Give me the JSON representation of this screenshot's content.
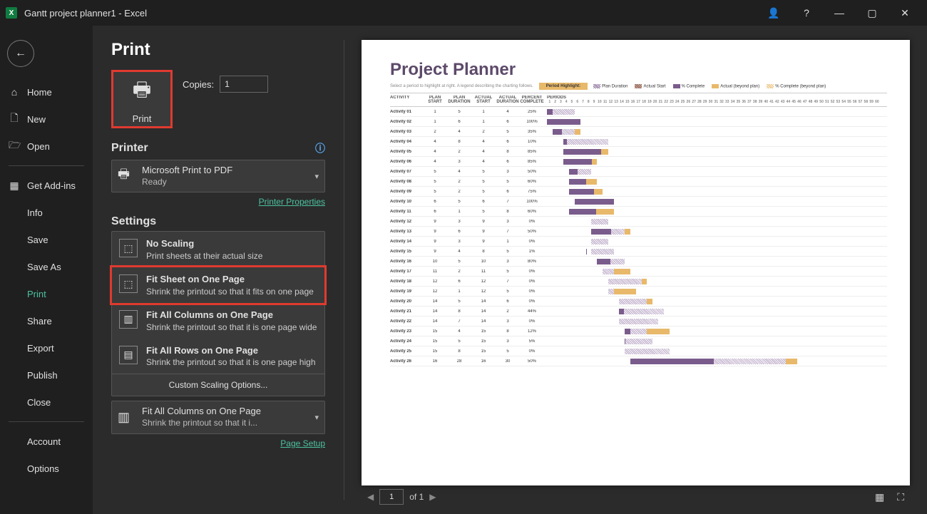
{
  "titlebar": {
    "app_icon": "X",
    "title": "Gantt project planner1  -  Excel"
  },
  "nav": {
    "home": "Home",
    "new": "New",
    "open": "Open",
    "getaddins": "Get Add-ins",
    "info": "Info",
    "save": "Save",
    "saveas": "Save As",
    "print": "Print",
    "share": "Share",
    "export": "Export",
    "publish": "Publish",
    "close": "Close",
    "account": "Account",
    "options": "Options"
  },
  "page": {
    "title": "Print",
    "copies_label": "Copies:",
    "copies_value": "1",
    "print_button": "Print"
  },
  "printer": {
    "section": "Printer",
    "name": "Microsoft Print to PDF",
    "status": "Ready",
    "properties": "Printer Properties"
  },
  "settings": {
    "section": "Settings",
    "custom": "Custom Scaling Options...",
    "page_setup": "Page Setup"
  },
  "scaling_options": [
    {
      "title": "No Scaling",
      "desc": "Print sheets at their actual size"
    },
    {
      "title": "Fit Sheet on One Page",
      "desc": "Shrink the printout so that it fits on one page"
    },
    {
      "title": "Fit All Columns on One Page",
      "desc": "Shrink the printout so that it is one page wide"
    },
    {
      "title": "Fit All Rows on One Page",
      "desc": "Shrink the printout so that it is one page high"
    }
  ],
  "current_setting": {
    "title": "Fit All Columns on One Page",
    "desc": "Shrink the printout so that it i..."
  },
  "pager": {
    "current": "1",
    "total": "of 1"
  },
  "preview": {
    "title": "Project Planner",
    "subtitle": "Select a period to highlight at right. A legend describing the charting follows.",
    "period_highlight": "Period Highlight:",
    "legend": {
      "pd": "Plan Duration",
      "as": "Actual Start",
      "pc": "% Complete",
      "ab": "Actual (beyond plan)",
      "cb": "% Complete (beyond plan)"
    },
    "headers": {
      "activity": "ACTIVITY",
      "planstart": "PLAN START",
      "plandur": "PLAN DURATION",
      "actstart": "ACTUAL START",
      "actdur": "ACTUAL DURATION",
      "pct": "PERCENT COMPLETE",
      "periods": "PERIODS"
    },
    "rows": [
      {
        "a": "Activity 01",
        "ps": 1,
        "pd": 5,
        "as": 1,
        "ad": 4,
        "pc": "25%"
      },
      {
        "a": "Activity 02",
        "ps": 1,
        "pd": 6,
        "as": 1,
        "ad": 6,
        "pc": "100%"
      },
      {
        "a": "Activity 03",
        "ps": 2,
        "pd": 4,
        "as": 2,
        "ad": 5,
        "pc": "35%"
      },
      {
        "a": "Activity 04",
        "ps": 4,
        "pd": 8,
        "as": 4,
        "ad": 6,
        "pc": "10%"
      },
      {
        "a": "Activity 05",
        "ps": 4,
        "pd": 2,
        "as": 4,
        "ad": 8,
        "pc": "85%"
      },
      {
        "a": "Activity 06",
        "ps": 4,
        "pd": 3,
        "as": 4,
        "ad": 6,
        "pc": "85%"
      },
      {
        "a": "Activity 07",
        "ps": 5,
        "pd": 4,
        "as": 5,
        "ad": 3,
        "pc": "50%"
      },
      {
        "a": "Activity 08",
        "ps": 5,
        "pd": 2,
        "as": 5,
        "ad": 5,
        "pc": "60%"
      },
      {
        "a": "Activity 09",
        "ps": 5,
        "pd": 2,
        "as": 5,
        "ad": 6,
        "pc": "75%"
      },
      {
        "a": "Activity 10",
        "ps": 6,
        "pd": 5,
        "as": 6,
        "ad": 7,
        "pc": "100%"
      },
      {
        "a": "Activity 11",
        "ps": 6,
        "pd": 1,
        "as": 5,
        "ad": 8,
        "pc": "60%"
      },
      {
        "a": "Activity 12",
        "ps": 9,
        "pd": 3,
        "as": 9,
        "ad": 3,
        "pc": "0%"
      },
      {
        "a": "Activity 13",
        "ps": 9,
        "pd": 6,
        "as": 9,
        "ad": 7,
        "pc": "50%"
      },
      {
        "a": "Activity 14",
        "ps": 9,
        "pd": 3,
        "as": 9,
        "ad": 1,
        "pc": "0%"
      },
      {
        "a": "Activity 15",
        "ps": 9,
        "pd": 4,
        "as": 8,
        "ad": 5,
        "pc": "1%"
      },
      {
        "a": "Activity 16",
        "ps": 10,
        "pd": 5,
        "as": 10,
        "ad": 3,
        "pc": "80%"
      },
      {
        "a": "Activity 17",
        "ps": 11,
        "pd": 2,
        "as": 11,
        "ad": 5,
        "pc": "0%"
      },
      {
        "a": "Activity 18",
        "ps": 12,
        "pd": 6,
        "as": 12,
        "ad": 7,
        "pc": "0%"
      },
      {
        "a": "Activity 19",
        "ps": 12,
        "pd": 1,
        "as": 12,
        "ad": 5,
        "pc": "0%"
      },
      {
        "a": "Activity 20",
        "ps": 14,
        "pd": 5,
        "as": 14,
        "ad": 6,
        "pc": "0%"
      },
      {
        "a": "Activity 21",
        "ps": 14,
        "pd": 8,
        "as": 14,
        "ad": 2,
        "pc": "44%"
      },
      {
        "a": "Activity 22",
        "ps": 14,
        "pd": 7,
        "as": 14,
        "ad": 3,
        "pc": "0%"
      },
      {
        "a": "Activity 23",
        "ps": 15,
        "pd": 4,
        "as": 15,
        "ad": 8,
        "pc": "12%"
      },
      {
        "a": "Activity 24",
        "ps": 15,
        "pd": 5,
        "as": 15,
        "ad": 3,
        "pc": "5%"
      },
      {
        "a": "Activity 25",
        "ps": 15,
        "pd": 8,
        "as": 15,
        "ad": 5,
        "pc": "0%"
      },
      {
        "a": "Activity 26",
        "ps": 16,
        "pd": 28,
        "as": 16,
        "ad": 30,
        "pc": "50%"
      }
    ]
  }
}
